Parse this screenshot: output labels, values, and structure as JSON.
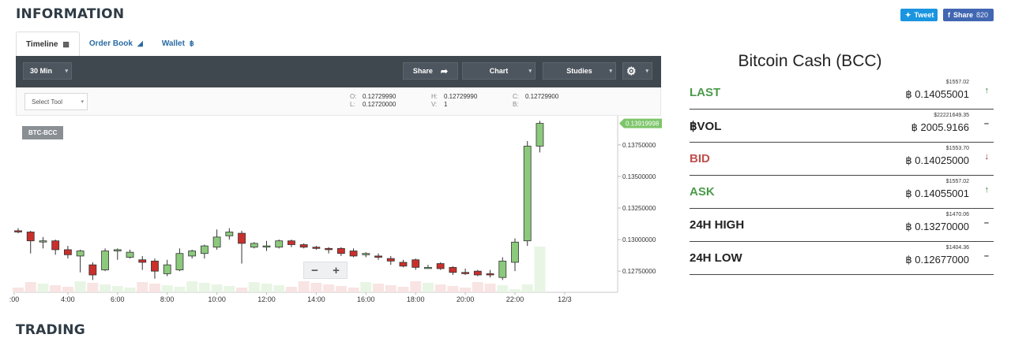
{
  "header": {
    "title": "INFORMATION"
  },
  "social": {
    "tweet_label": "Tweet",
    "share_label": "Share",
    "share_count": "820"
  },
  "tabs": [
    {
      "label": "Timeline",
      "icon": "bar-chart-icon"
    },
    {
      "label": "Order Book",
      "icon": "area-chart-icon"
    },
    {
      "label": "Wallet",
      "icon": "bitcoin-icon"
    }
  ],
  "toolbar": {
    "timeframe": "30 Min",
    "share_label": "Share",
    "chart_label": "Chart",
    "studies_label": "Studies"
  },
  "select_tool": {
    "label": "Select Tool"
  },
  "ohlc": {
    "open_key": "O:",
    "open": "0.12729990",
    "low_key": "L:",
    "low": "0.12720000",
    "high_key": "H:",
    "high": "0.12729990",
    "volume_key": "V:",
    "volume": "1",
    "close_key": "C:",
    "close": "0.12729900",
    "bid_key": "B:",
    "bid": ""
  },
  "chart_data": {
    "type": "candlestick",
    "symbol": "BTC-BCC",
    "ylim": [
      0.1262,
      0.1398
    ],
    "y_ticks": [
      "0.13750000",
      "0.13500000",
      "0.13250000",
      "0.13000000",
      "0.12750000"
    ],
    "y_tick_values": [
      0.1375,
      0.135,
      0.1325,
      0.13,
      0.1275
    ],
    "current_price_label": "0.13919998",
    "current_price": 0.1392,
    "x_ticks": [
      ":00",
      "4:00",
      "6:00",
      "8:00",
      "10:00",
      "12:00",
      "14:00",
      "16:00",
      "18:00",
      "20:00",
      "22:00",
      "12/3"
    ],
    "x_tick_hours": [
      2,
      4,
      6,
      8,
      10,
      12,
      14,
      16,
      18,
      20,
      22,
      24
    ],
    "candles": [
      {
        "t": 2.0,
        "o": 0.1307,
        "h": 0.1309,
        "l": 0.1305,
        "c": 0.1306
      },
      {
        "t": 2.5,
        "o": 0.1306,
        "h": 0.1307,
        "l": 0.1289,
        "c": 0.1299
      },
      {
        "t": 3.0,
        "o": 0.1299,
        "h": 0.1302,
        "l": 0.1293,
        "c": 0.1299
      },
      {
        "t": 3.5,
        "o": 0.1299,
        "h": 0.13,
        "l": 0.1288,
        "c": 0.1292
      },
      {
        "t": 4.0,
        "o": 0.1292,
        "h": 0.1295,
        "l": 0.1285,
        "c": 0.1288
      },
      {
        "t": 4.5,
        "o": 0.1287,
        "h": 0.1292,
        "l": 0.1274,
        "c": 0.1291
      },
      {
        "t": 5.0,
        "o": 0.128,
        "h": 0.1282,
        "l": 0.1268,
        "c": 0.1272
      },
      {
        "t": 5.5,
        "o": 0.1276,
        "h": 0.1293,
        "l": 0.1275,
        "c": 0.1291
      },
      {
        "t": 6.0,
        "o": 0.1291,
        "h": 0.1293,
        "l": 0.1284,
        "c": 0.1292
      },
      {
        "t": 6.5,
        "o": 0.1286,
        "h": 0.1292,
        "l": 0.1285,
        "c": 0.129
      },
      {
        "t": 7.0,
        "o": 0.1284,
        "h": 0.1287,
        "l": 0.1276,
        "c": 0.1282
      },
      {
        "t": 7.5,
        "o": 0.1283,
        "h": 0.1285,
        "l": 0.1269,
        "c": 0.1275
      },
      {
        "t": 8.0,
        "o": 0.1273,
        "h": 0.1284,
        "l": 0.1271,
        "c": 0.128
      },
      {
        "t": 8.5,
        "o": 0.1276,
        "h": 0.1293,
        "l": 0.1275,
        "c": 0.1289
      },
      {
        "t": 9.0,
        "o": 0.1287,
        "h": 0.1292,
        "l": 0.1285,
        "c": 0.1291
      },
      {
        "t": 9.5,
        "o": 0.1289,
        "h": 0.1296,
        "l": 0.1285,
        "c": 0.1295
      },
      {
        "t": 10.0,
        "o": 0.1294,
        "h": 0.1308,
        "l": 0.1292,
        "c": 0.1302
      },
      {
        "t": 10.5,
        "o": 0.1303,
        "h": 0.1309,
        "l": 0.13,
        "c": 0.1306
      },
      {
        "t": 11.0,
        "o": 0.1305,
        "h": 0.1307,
        "l": 0.1281,
        "c": 0.1297
      },
      {
        "t": 11.5,
        "o": 0.1294,
        "h": 0.1298,
        "l": 0.1293,
        "c": 0.1297
      },
      {
        "t": 12.0,
        "o": 0.1295,
        "h": 0.1299,
        "l": 0.1291,
        "c": 0.1295
      },
      {
        "t": 12.5,
        "o": 0.1294,
        "h": 0.13,
        "l": 0.1293,
        "c": 0.1299
      },
      {
        "t": 13.0,
        "o": 0.1299,
        "h": 0.13,
        "l": 0.1294,
        "c": 0.1296
      },
      {
        "t": 13.5,
        "o": 0.1296,
        "h": 0.1297,
        "l": 0.1293,
        "c": 0.1294
      },
      {
        "t": 14.0,
        "o": 0.1294,
        "h": 0.1295,
        "l": 0.1292,
        "c": 0.1293
      },
      {
        "t": 14.5,
        "o": 0.1293,
        "h": 0.1294,
        "l": 0.1289,
        "c": 0.1292
      },
      {
        "t": 15.0,
        "o": 0.1293,
        "h": 0.1294,
        "l": 0.1287,
        "c": 0.1289
      },
      {
        "t": 15.5,
        "o": 0.1291,
        "h": 0.1293,
        "l": 0.1286,
        "c": 0.1287
      },
      {
        "t": 16.0,
        "o": 0.1288,
        "h": 0.129,
        "l": 0.1286,
        "c": 0.1289
      },
      {
        "t": 16.5,
        "o": 0.1287,
        "h": 0.1289,
        "l": 0.1284,
        "c": 0.1286
      },
      {
        "t": 17.0,
        "o": 0.1285,
        "h": 0.1287,
        "l": 0.128,
        "c": 0.1283
      },
      {
        "t": 17.5,
        "o": 0.1282,
        "h": 0.1284,
        "l": 0.1278,
        "c": 0.1279
      },
      {
        "t": 18.0,
        "o": 0.1284,
        "h": 0.1285,
        "l": 0.1276,
        "c": 0.1278
      },
      {
        "t": 18.5,
        "o": 0.1278,
        "h": 0.128,
        "l": 0.1277,
        "c": 0.1278
      },
      {
        "t": 19.0,
        "o": 0.1281,
        "h": 0.1282,
        "l": 0.1276,
        "c": 0.1277
      },
      {
        "t": 19.5,
        "o": 0.1278,
        "h": 0.1279,
        "l": 0.1272,
        "c": 0.1274
      },
      {
        "t": 20.0,
        "o": 0.1274,
        "h": 0.1277,
        "l": 0.1272,
        "c": 0.1273
      },
      {
        "t": 20.5,
        "o": 0.1275,
        "h": 0.1276,
        "l": 0.1271,
        "c": 0.1272
      },
      {
        "t": 21.0,
        "o": 0.1273,
        "h": 0.1276,
        "l": 0.127,
        "c": 0.1272
      },
      {
        "t": 21.5,
        "o": 0.127,
        "h": 0.1286,
        "l": 0.1268,
        "c": 0.1283
      },
      {
        "t": 22.0,
        "o": 0.1282,
        "h": 0.1301,
        "l": 0.1275,
        "c": 0.1298
      },
      {
        "t": 22.5,
        "o": 0.1299,
        "h": 0.1378,
        "l": 0.1295,
        "c": 0.1374
      },
      {
        "t": 23.0,
        "o": 0.1374,
        "h": 0.1394,
        "l": 0.1369,
        "c": 0.1392
      }
    ],
    "volume_series": "faint"
  },
  "market": {
    "title": "Bitcoin Cash (BCC)",
    "rows": [
      {
        "label": "LAST",
        "usd": "$1557.02",
        "btc": "฿ 0.14055001",
        "arrow": "↑",
        "label_color": "#4a9a4a",
        "arrow_color": "#2e7d32"
      },
      {
        "label": "฿VOL",
        "usd": "$22221649.35",
        "btc": "฿ 2005.9166",
        "arrow": "–",
        "label_color": "#222222",
        "arrow_color": "#333333"
      },
      {
        "label": "BID",
        "usd": "$1553.70",
        "btc": "฿ 0.14025000",
        "arrow": "↓",
        "label_color": "#c0504d",
        "arrow_color": "#8b1a1a"
      },
      {
        "label": "ASK",
        "usd": "$1557.02",
        "btc": "฿ 0.14055001",
        "arrow": "↑",
        "label_color": "#4a9a4a",
        "arrow_color": "#2e7d32"
      },
      {
        "label": "24H HIGH",
        "usd": "$1470.06",
        "btc": "฿ 0.13270000",
        "arrow": "–",
        "label_color": "#222222",
        "arrow_color": "#333333"
      },
      {
        "label": "24H LOW",
        "usd": "$1404.36",
        "btc": "฿ 0.12677000",
        "arrow": "–",
        "label_color": "#222222",
        "arrow_color": "#333333"
      }
    ]
  },
  "trading": {
    "title": "TRADING"
  },
  "colors": {
    "up": "#8cc97d",
    "down": "#c9302c",
    "toolbar": "#40484f",
    "accent": "#2a6ba3"
  }
}
